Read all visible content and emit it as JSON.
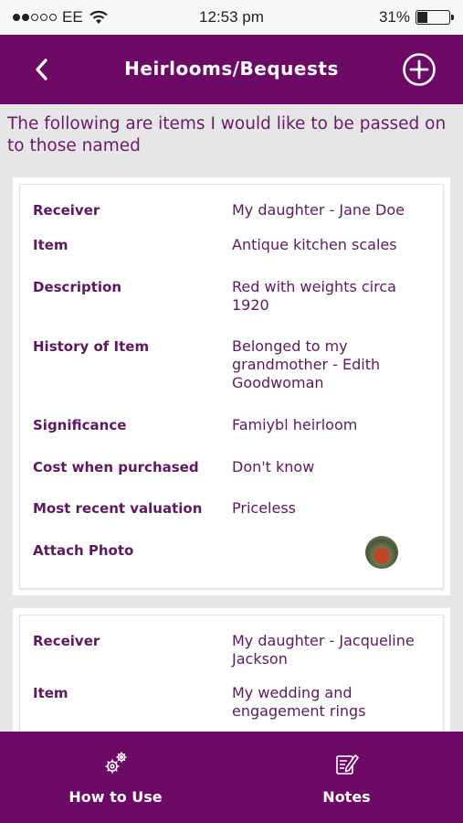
{
  "status_bar": {
    "carrier": "EE",
    "time": "12:53 pm",
    "battery_percent": "31%",
    "battery_level": 0.31,
    "signal_bars_filled": 2,
    "signal_bars_total": 5
  },
  "header": {
    "title": "Heirlooms/Bequests",
    "back_icon": "chevron-left-icon",
    "add_icon": "plus-circle-icon",
    "background": "#6c0a66"
  },
  "intro_text": "The following are items I would like to be passed on to those named",
  "cards": [
    {
      "rows": [
        {
          "label": "Receiver",
          "value": "My daughter - Jane Doe"
        },
        {
          "label": "Item",
          "value": "Antique kitchen scales"
        },
        {
          "label": "Description",
          "value": "Red with weights circa 1920"
        },
        {
          "label": "History of Item",
          "value": "Belonged to my grandmother - Edith Goodwoman"
        },
        {
          "label": "Significance",
          "value": "Famiybl heirloom"
        },
        {
          "label": "Cost when purchased",
          "value": "Don't know"
        },
        {
          "label": "Most recent valuation",
          "value": "Priceless"
        },
        {
          "label": "Attach Photo",
          "value": ""
        }
      ]
    },
    {
      "rows": [
        {
          "label": "Receiver",
          "value": "My daughter - Jacqueline Jackson"
        },
        {
          "label": "Item",
          "value": "My wedding and engagement rings"
        }
      ]
    }
  ],
  "bottom_nav": [
    {
      "label": "How to Use",
      "icon": "gears-icon"
    },
    {
      "label": "Notes",
      "icon": "notes-edit-icon"
    }
  ],
  "colors": {
    "brand_purple": "#6c0a66",
    "text_purple": "#5e1860",
    "page_bg": "#e6e6e6"
  }
}
